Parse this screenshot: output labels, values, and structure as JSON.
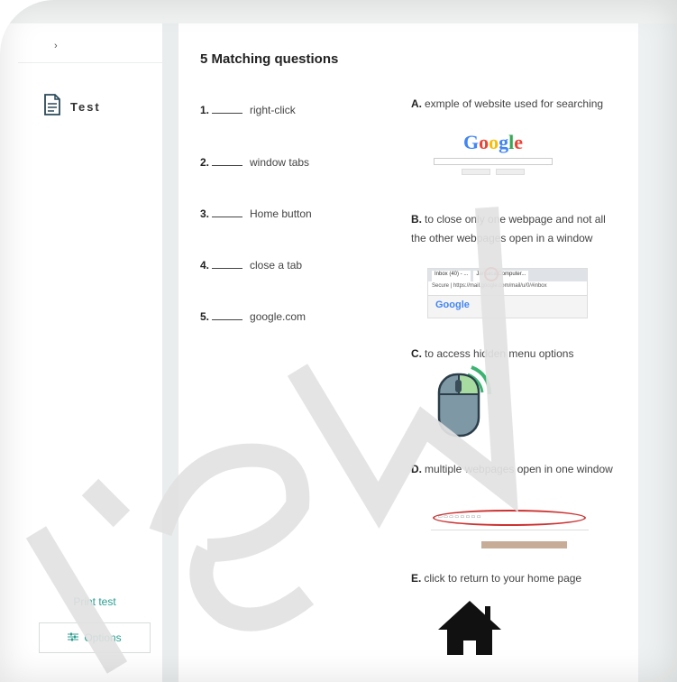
{
  "sidebar": {
    "back_label": "›",
    "items": [
      {
        "label": "Test",
        "icon": "document-icon"
      }
    ],
    "print_label": "Print test",
    "options_label": "Options",
    "options_icon": "sliders-icon"
  },
  "main": {
    "title": "5 Matching questions",
    "questions": [
      {
        "num": "1.",
        "text": "right-click"
      },
      {
        "num": "2.",
        "text": "window tabs"
      },
      {
        "num": "3.",
        "text": "Home button"
      },
      {
        "num": "4.",
        "text": "close a tab"
      },
      {
        "num": "5.",
        "text": "google.com"
      }
    ],
    "answers": [
      {
        "letter": "A.",
        "text": "exmple of website used for searching"
      },
      {
        "letter": "B.",
        "text": "to close only one webpage and not all the other webpages open in a window"
      },
      {
        "letter": "C.",
        "text": "to access hidden menu options"
      },
      {
        "letter": "D.",
        "text": "multiple webpages open in one window"
      },
      {
        "letter": "E.",
        "text": "click to return to your home page"
      }
    ]
  },
  "images": {
    "google_logo": "Google",
    "browser_tab_1": "Inbox (40) - ...",
    "browser_tab_2": "Jamaica Computer...",
    "browser_address": "Secure | https://mail.google.com/mail/u/0/#inbox",
    "browser_logo": "Google"
  },
  "colors": {
    "accent": "#2a9d8f",
    "watermark": "#e2e2e2",
    "highlight_circle": "#dd3333"
  },
  "watermark_text": "Preview"
}
